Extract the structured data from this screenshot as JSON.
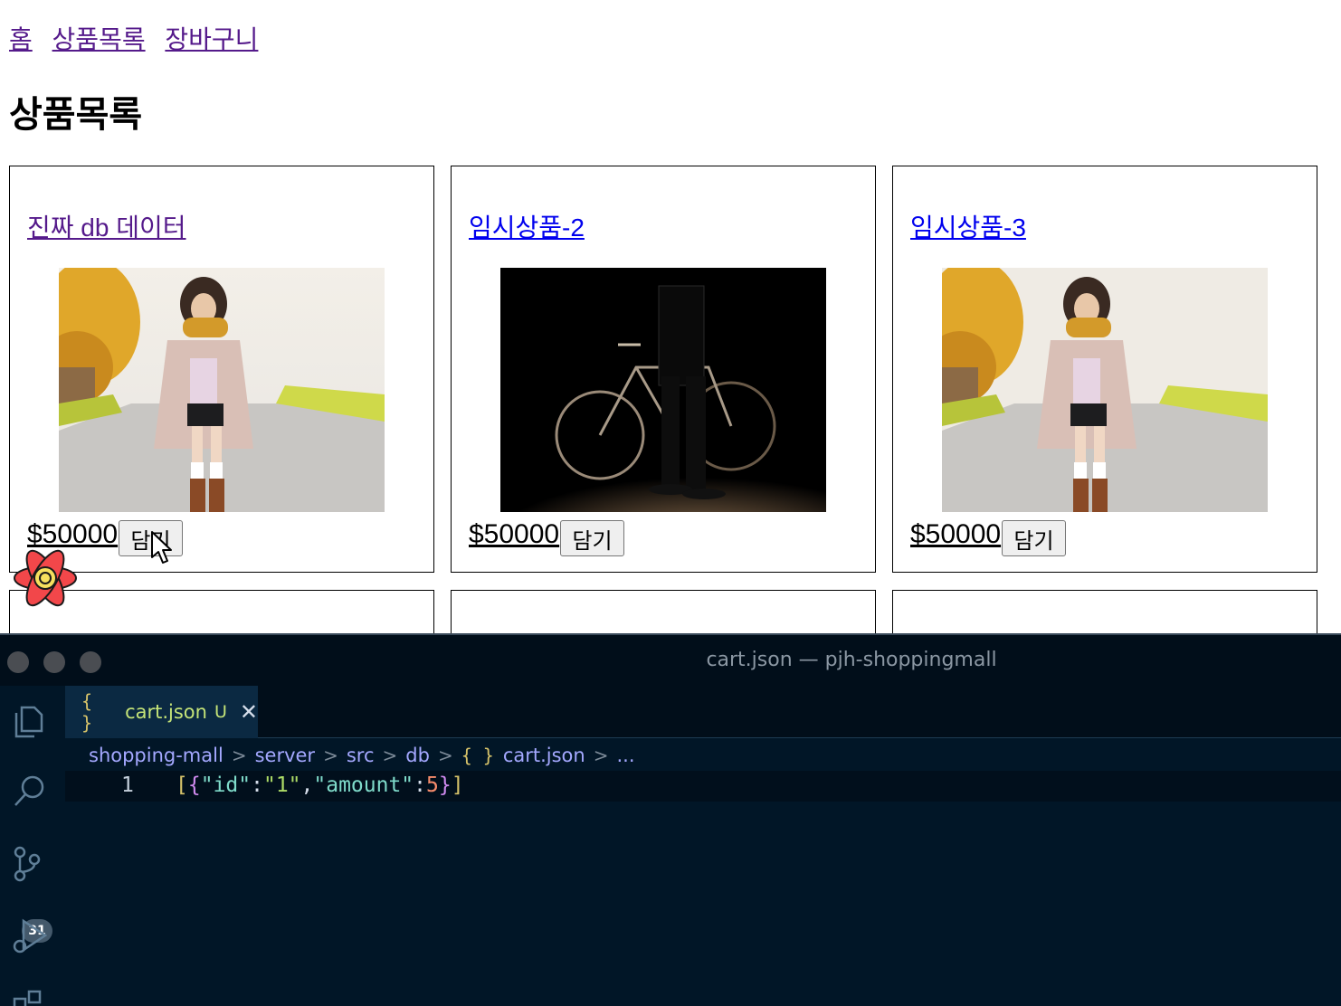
{
  "nav": {
    "links": [
      "홈",
      "상품목록",
      "장바구니"
    ]
  },
  "page": {
    "title": "상품목록"
  },
  "products": [
    {
      "name": "진짜 db 데이터",
      "price": "$50000",
      "button": "담기",
      "image": "woman-in-coat-photo"
    },
    {
      "name": "임시상품-2",
      "price": "$50000",
      "button": "담기",
      "image": "bicycle-silhouette-photo"
    },
    {
      "name": "임시상품-3",
      "price": "$50000",
      "button": "담기",
      "image": "woman-in-coat-photo"
    }
  ],
  "vscode": {
    "window_title": "cart.json — pjh-shoppingmall",
    "tab": {
      "icon": "{ }",
      "name": "cart.json",
      "status": "U",
      "close": "✕"
    },
    "breadcrumb": [
      "shopping-mall",
      "server",
      "src",
      "db",
      "cart.json",
      "..."
    ],
    "scm_badge": "31",
    "line_number": "1",
    "code_tokens": [
      "[",
      "{",
      "\"id\"",
      ":",
      "\"1\"",
      ",",
      "\"amount\"",
      ":",
      "5",
      "}",
      "]"
    ]
  },
  "colors": {
    "link_visited": "#551a8b",
    "link_unvisited": "#0000ee",
    "editor_bg": "#011627"
  }
}
